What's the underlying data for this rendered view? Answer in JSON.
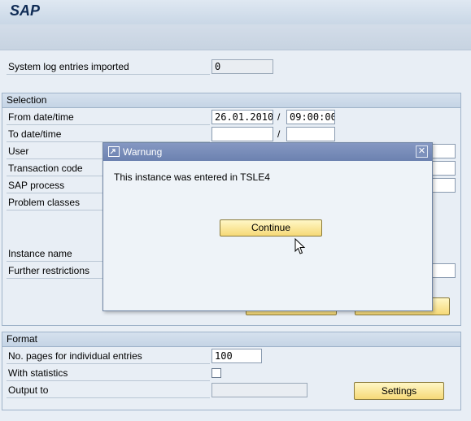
{
  "app": {
    "title": "SAP"
  },
  "top": {
    "entries_label": "System log entries imported",
    "entries_value": "0"
  },
  "selection": {
    "heading": "Selection",
    "from_label": "From date/time",
    "from_date": "26.01.2010",
    "from_time": "09:00:00",
    "to_label": "To date/time",
    "to_date": "",
    "to_time": "",
    "date_time_sep": "/",
    "user_label": "User",
    "tcode_label": "Transaction code",
    "process_label": "SAP process",
    "problem_label": "Problem classes",
    "instance_label": "Instance name",
    "further_label": "Further restrictions"
  },
  "format": {
    "heading": "Format",
    "pages_label": "No. pages for individual entries",
    "pages_value": "100",
    "stats_label": "With statistics",
    "output_label": "Output to",
    "output_value": "",
    "settings_label": "Settings"
  },
  "dialog": {
    "title": "Warnung",
    "close_glyph": "✕",
    "message": "This instance was entered in TSLE4",
    "continue_label": "Continue"
  },
  "colors": {
    "dialog_header": "#7388b5",
    "button_yellow": "#f6d977",
    "screen_bg": "#e8eef5"
  },
  "icons": {
    "dialog": "window-icon",
    "close": "close-icon",
    "cursor": "mouse-cursor-icon"
  }
}
